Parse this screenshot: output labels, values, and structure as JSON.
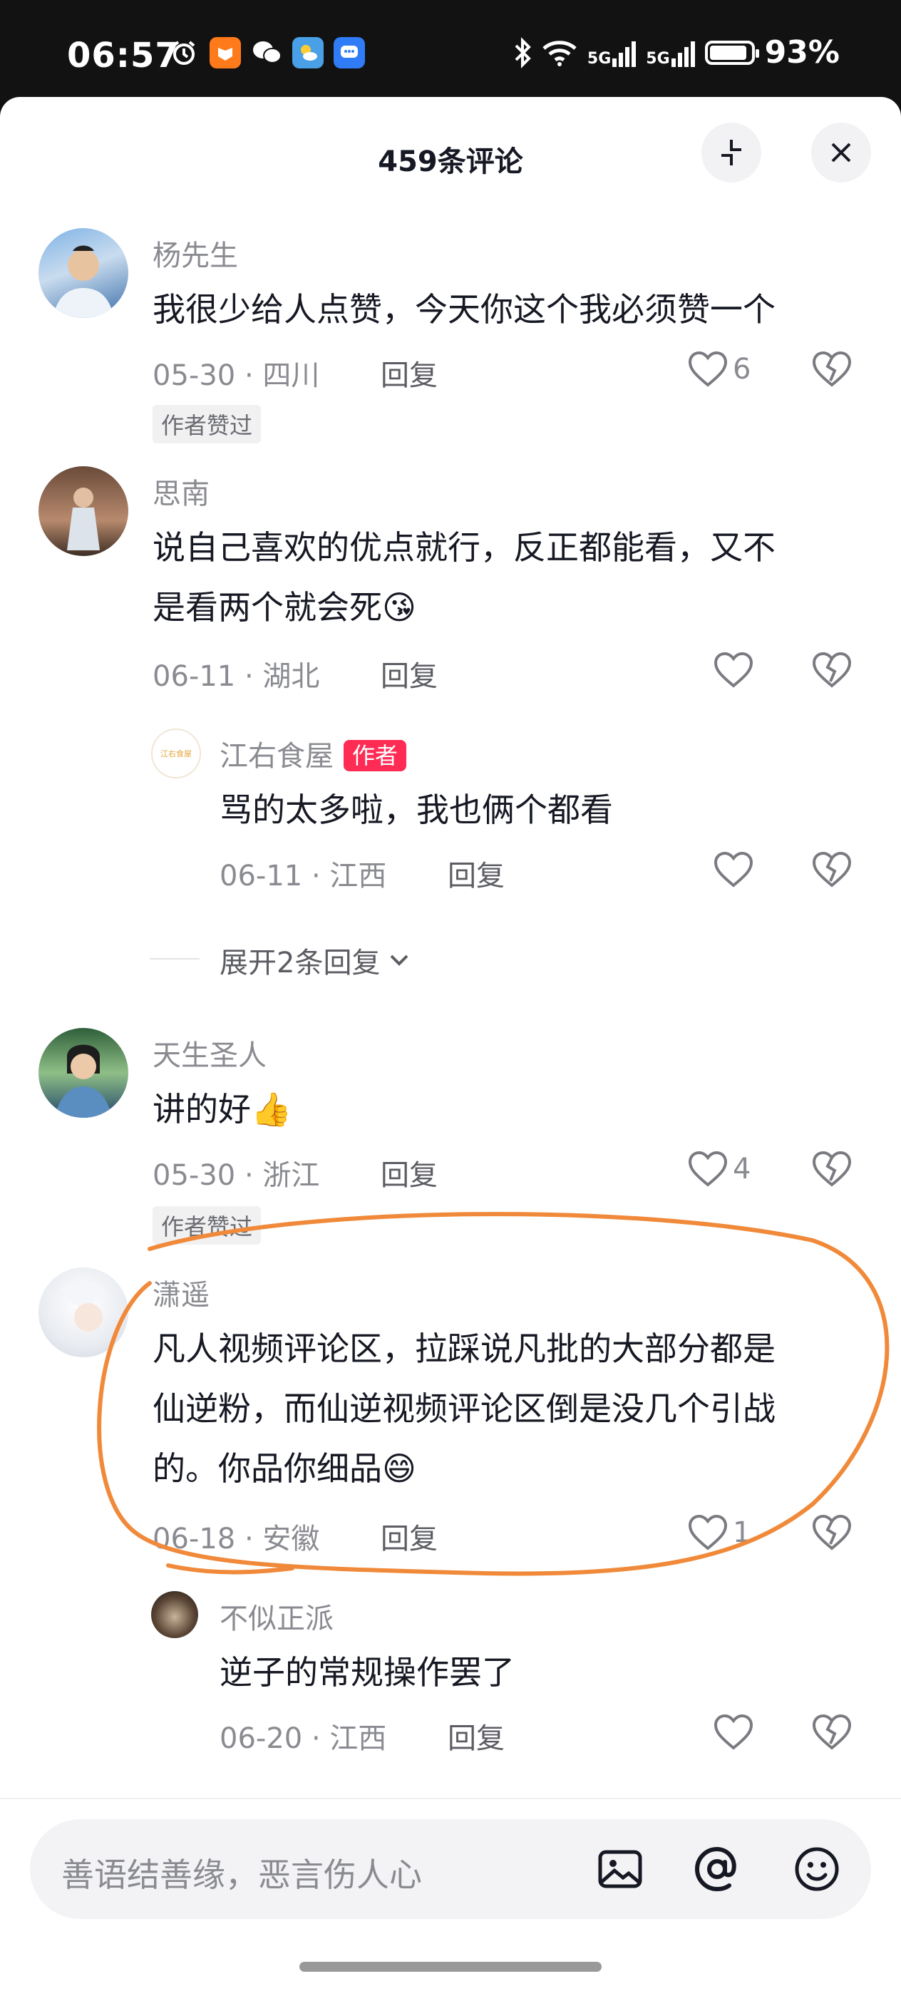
{
  "status": {
    "time": "06:57",
    "net1": "5G",
    "net2": "5G",
    "battery": "93%"
  },
  "header": {
    "title": "459条评论"
  },
  "comments": [
    {
      "user": "杨先生",
      "text_lines": [
        "我很少给人点赞，今天你这个我必须赞一个"
      ],
      "date_loc": "05-30 · 四川",
      "reply_label": "回复",
      "likes": "6",
      "badge": "作者赞过"
    },
    {
      "user": "思南",
      "text_lines": [
        "说自己喜欢的优点就行，反正都能看，又不",
        "是看两个就会死😘"
      ],
      "date_loc": "06-11 · 湖北",
      "reply_label": "回复",
      "likes": "",
      "reply": {
        "user": "江右食屋",
        "author_tag": "作者",
        "avatar_text": "江右食屋",
        "text_lines": [
          "骂的太多啦，我也俩个都看"
        ],
        "date_loc": "06-11 · 江西",
        "reply_label": "回复"
      },
      "expand_label": "展开2条回复"
    },
    {
      "user": "天生圣人",
      "text_lines": [
        "讲的好👍"
      ],
      "date_loc": "05-30 · 浙江",
      "reply_label": "回复",
      "likes": "4",
      "badge": "作者赞过"
    },
    {
      "user": "潇遥",
      "text_lines": [
        "凡人视频评论区，拉踩说凡批的大部分都是",
        "仙逆粉，而仙逆视频评论区倒是没几个引战",
        "的。你品你细品😄"
      ],
      "date_loc": "06-18 · 安徽",
      "reply_label": "回复",
      "likes": "1",
      "reply": {
        "user": "不似正派",
        "text_lines": [
          "逆子的常规操作罢了"
        ],
        "date_loc": "06-20 · 江西",
        "reply_label": "回复"
      }
    }
  ],
  "input": {
    "placeholder": "善语结善缘，恶言伤人心"
  },
  "icons": {
    "collapse": "collapse-icon",
    "close": "close-icon",
    "heart": "heart-icon",
    "dislike": "broken-heart-icon",
    "image": "image-icon",
    "at": "at-icon",
    "emoji": "emoji-icon",
    "chevron": "chevron-down-icon"
  },
  "colors": {
    "accent": "#fe2c55",
    "annotation": "#f08a3a",
    "text": "#161823",
    "muted": "#8a8b91"
  }
}
